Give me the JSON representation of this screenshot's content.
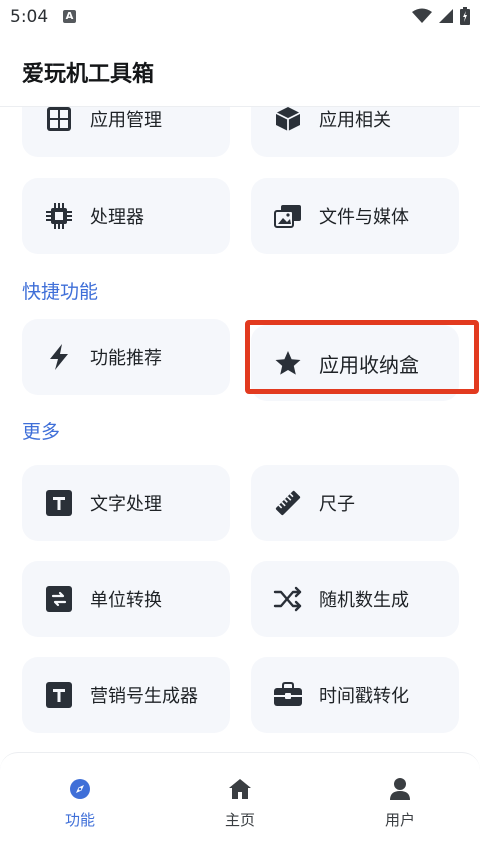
{
  "status_bar": {
    "time": "5:04",
    "notif_letter": "A"
  },
  "app_bar": {
    "title": "爱玩机工具箱"
  },
  "tools_top": [
    {
      "label": "应用管理",
      "icon": "grid-icon"
    },
    {
      "label": "应用相关",
      "icon": "cube-icon"
    },
    {
      "label": "处理器",
      "icon": "chip-icon"
    },
    {
      "label": "文件与媒体",
      "icon": "photos-icon"
    }
  ],
  "sections": {
    "quick": {
      "title": "快捷功能",
      "items": [
        {
          "label": "功能推荐",
          "icon": "lightning-icon"
        },
        {
          "label": "应用收纳盒",
          "icon": "star-icon"
        }
      ]
    },
    "more": {
      "title": "更多",
      "items": [
        {
          "label": "文字处理",
          "icon": "text-t-icon"
        },
        {
          "label": "尺子",
          "icon": "ruler-icon"
        },
        {
          "label": "单位转换",
          "icon": "swap-icon"
        },
        {
          "label": "随机数生成",
          "icon": "shuffle-icon"
        },
        {
          "label": "营销号生成器",
          "icon": "text-t-icon"
        },
        {
          "label": "时间戳转化",
          "icon": "toolbox-icon"
        }
      ]
    }
  },
  "bottom_nav": [
    {
      "label": "功能",
      "icon": "compass-icon",
      "active": true
    },
    {
      "label": "主页",
      "icon": "home-icon",
      "active": false
    },
    {
      "label": "用户",
      "icon": "user-icon",
      "active": false
    }
  ],
  "colors": {
    "accent": "#3f6fd8",
    "tile_bg": "#f5f7fb",
    "highlight": "#e23a1f",
    "icon_dark": "#2a3038"
  }
}
